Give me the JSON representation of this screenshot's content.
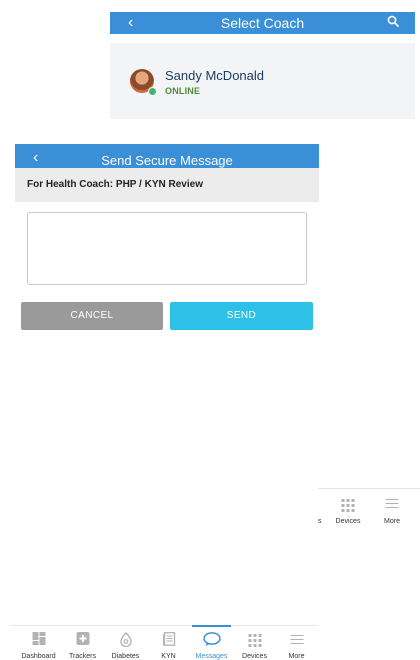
{
  "select_coach": {
    "title": "Select Coach",
    "coach": {
      "name": "Sandy McDonald",
      "status": "ONLINE"
    }
  },
  "send_message": {
    "title": "Send Secure Message",
    "subject": "For Health Coach: PHP / KYN Review",
    "message_value": "",
    "cancel_label": "CANCEL",
    "send_label": "SEND"
  },
  "partial_nav": {
    "truncated_label": "s",
    "items": [
      {
        "label": "Devices",
        "icon": "devices-icon"
      },
      {
        "label": "More",
        "icon": "menu-icon"
      }
    ]
  },
  "bottom_nav": {
    "active": "Messages",
    "items": [
      {
        "label": "Dashboard",
        "icon": "dashboard-icon"
      },
      {
        "label": "Trackers",
        "icon": "trackers-icon"
      },
      {
        "label": "Diabetes",
        "icon": "diabetes-icon"
      },
      {
        "label": "KYN",
        "icon": "kyn-icon"
      },
      {
        "label": "Messages",
        "icon": "messages-icon"
      },
      {
        "label": "Devices",
        "icon": "devices-icon"
      },
      {
        "label": "More",
        "icon": "menu-icon"
      }
    ]
  },
  "colors": {
    "header_blue": "#3a8fd6",
    "send_button": "#2ec1e8",
    "cancel_button": "#9a9a9a",
    "online_green": "#4f8a3a"
  }
}
